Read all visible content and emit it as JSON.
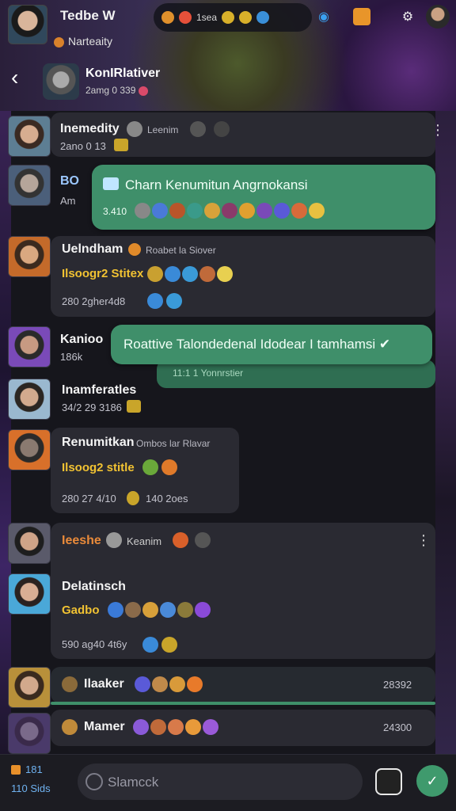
{
  "app": {
    "title": "Tedbe W",
    "subtitle": "Narteaity",
    "status": "1sea"
  },
  "channel": {
    "title": "KonIRlativer",
    "subtitle": "2amg 0 339"
  },
  "messages": [
    {
      "name": "Inemedity",
      "tag": "Leenim",
      "meta": "2ano 0 13"
    },
    {
      "name": "BO",
      "meta": "Am",
      "bubble_text": "Charn Kenumitun Angrnokansi",
      "bubble_meta": "3.410"
    },
    {
      "name": "Uelndham",
      "tag": "Roabet la Siover",
      "highlight": "Ilsoogr2 Stitex",
      "meta": "280 2gher4d8"
    },
    {
      "name": "Kanioo",
      "meta": "186k",
      "bubble_text": "Roattive Talondedenal Idodear I tamhamsi ✔",
      "bubble_meta": "11:1 1 Yonnrstier"
    },
    {
      "name": "Inamferatles",
      "meta": "34/2 29 3186"
    },
    {
      "name": "Renumitkan",
      "tag": "Ombos lar Rlavar",
      "highlight": "Ilsoog2 stitle",
      "meta": "280 27 4/10",
      "extra": "140 2oes"
    },
    {
      "name": "Ieeshe",
      "tag": "Keanim"
    },
    {
      "name": "Delatinsch",
      "highlight": "Gadbo",
      "meta": "590 ag40 4t6y"
    },
    {
      "name": "Ilaaker",
      "meta": "28392"
    },
    {
      "name": "Mamer",
      "meta": "24300"
    }
  ],
  "bottom": {
    "counter": "181",
    "label": "110 Sids",
    "search_placeholder": "Slamcck"
  },
  "colors": {
    "accent_green": "#3f8f6a",
    "highlight_yellow": "#f1c232",
    "card_bg": "#2a2a32"
  }
}
